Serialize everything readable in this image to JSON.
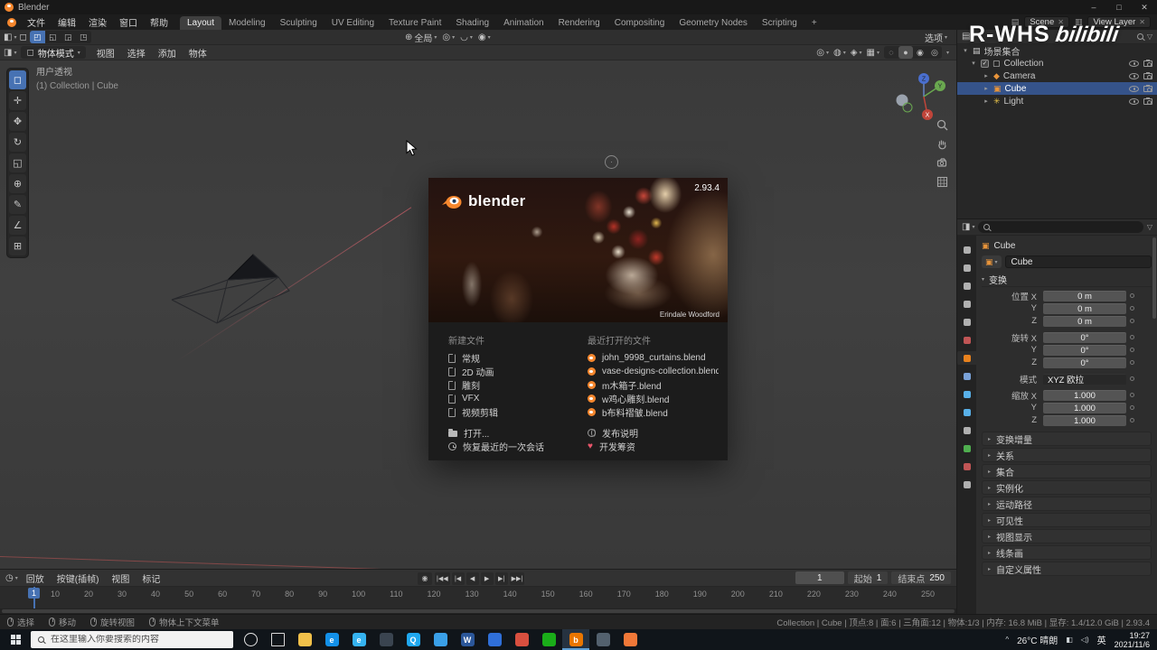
{
  "titlebar": {
    "title": "Blender",
    "min": "–",
    "max": "□",
    "close": "✕"
  },
  "watermark": {
    "part1": "R-WHS",
    "part2": "bilibili"
  },
  "menubar": {
    "menus": [
      "文件",
      "编辑",
      "渲染",
      "窗口",
      "帮助"
    ],
    "workspaces": [
      {
        "label": "Layout",
        "active": true
      },
      {
        "label": "Modeling"
      },
      {
        "label": "Sculpting"
      },
      {
        "label": "UV Editing"
      },
      {
        "label": "Texture Paint"
      },
      {
        "label": "Shading"
      },
      {
        "label": "Animation"
      },
      {
        "label": "Rendering"
      },
      {
        "label": "Compositing"
      },
      {
        "label": "Geometry Nodes"
      },
      {
        "label": "Scripting"
      },
      {
        "label": "+"
      }
    ],
    "scene_label": "Scene",
    "view_layer_label": "View Layer"
  },
  "tool_settings": {
    "orientation_glyph": "⊕",
    "orientation": "全局",
    "pivot_glyph": "◎",
    "magnet_glyph": "◡",
    "falloff_glyph": "◉",
    "options": "选项",
    "select_modes": [
      {
        "glyph": "◰",
        "active": true
      },
      {
        "glyph": "◱"
      },
      {
        "glyph": "◲"
      },
      {
        "glyph": "◳"
      }
    ]
  },
  "viewport": {
    "header": {
      "mode": "物体模式",
      "menus": [
        "视图",
        "选择",
        "添加",
        "物体"
      ]
    },
    "shading_modes": [
      {
        "glyph": "◌"
      },
      {
        "glyph": "●",
        "active": true
      },
      {
        "glyph": "◉"
      },
      {
        "glyph": "◎"
      }
    ],
    "header_icons": [
      {
        "glyph": "◎"
      },
      {
        "glyph": "◍"
      },
      {
        "glyph": "◈"
      },
      {
        "glyph": "▦"
      }
    ],
    "tools": [
      {
        "glyph": "◻",
        "name": "select-box",
        "active": true
      },
      {
        "glyph": "✛",
        "name": "cursor"
      },
      {
        "glyph": "✥",
        "name": "move"
      },
      {
        "glyph": "↻",
        "name": "rotate"
      },
      {
        "glyph": "◱",
        "name": "scale"
      },
      {
        "glyph": "⊕",
        "name": "transform"
      },
      {
        "glyph": "✎",
        "name": "annotate"
      },
      {
        "glyph": "∠",
        "name": "measure"
      },
      {
        "glyph": "⊞",
        "name": "add-cube"
      }
    ],
    "overlay": {
      "line1": "用户透视",
      "line2": "(1) Collection | Cube"
    },
    "gizmo": {
      "x": "X",
      "y": "Y",
      "z": "Z"
    }
  },
  "splash": {
    "version": "2.93.4",
    "brand": "blender",
    "credit": "Erindale Woodford",
    "new_file_title": "新建文件",
    "new_file_items": [
      "常规",
      "2D 动画",
      "雕刻",
      "VFX",
      "视频剪辑"
    ],
    "open_label": "打开...",
    "recover_label": "恢复最近的一次会话",
    "recent_title": "最近打开的文件",
    "recent_items": [
      "john_9998_curtains.blend",
      "vase-designs-collection.blend",
      "m木箱子.blend",
      "w鸡心雕刻.blend",
      "b布料褶皱.blend"
    ],
    "release_notes": "发布说明",
    "dev_fund": "开发筹资"
  },
  "outliner": {
    "root": "场景集合",
    "rows": [
      {
        "label": "Collection",
        "glyph": "▢",
        "color": "#d8d8d8",
        "lvl1": true,
        "expanded": true,
        "checkbox": true
      },
      {
        "label": "Camera",
        "glyph": "◆",
        "color": "#e8943a",
        "lvl2": true
      },
      {
        "label": "Cube",
        "glyph": "▣",
        "color": "#e8943a",
        "lvl2": true,
        "selected": true
      },
      {
        "label": "Light",
        "glyph": "✳",
        "color": "#e8c44a",
        "lvl2": true
      }
    ]
  },
  "properties": {
    "breadcrumb": "Cube",
    "name_value": "Cube",
    "transform_title": "变换",
    "tabs": [
      {
        "name": "tool",
        "color": "#b0b0b0"
      },
      {
        "name": "render",
        "color": "#b0b0b0"
      },
      {
        "name": "output",
        "color": "#b0b0b0"
      },
      {
        "name": "view-layer",
        "color": "#b0b0b0"
      },
      {
        "name": "scene",
        "color": "#b0b0b0"
      },
      {
        "name": "world",
        "color": "#c05555"
      },
      {
        "name": "object",
        "color": "#e8821e",
        "active": true
      },
      {
        "name": "modifiers",
        "color": "#7aa2d8"
      },
      {
        "name": "particles",
        "color": "#58b0e8"
      },
      {
        "name": "physics",
        "color": "#58b0e8"
      },
      {
        "name": "constraints",
        "color": "#b0b0b0"
      },
      {
        "name": "object-data",
        "color": "#4fae4f"
      },
      {
        "name": "material",
        "color": "#c05555"
      },
      {
        "name": "texture",
        "color": "#b0b0b0"
      }
    ],
    "fields": [
      {
        "label": "位置 X",
        "value": "0 m"
      },
      {
        "label": "Y",
        "value": "0 m"
      },
      {
        "label": "Z",
        "value": "0 m"
      },
      {
        "label": "旋转 X",
        "value": "0°",
        "gap_before": true
      },
      {
        "label": "Y",
        "value": "0°"
      },
      {
        "label": "Z",
        "value": "0°"
      },
      {
        "label": "模式",
        "value": "XYZ 欧拉",
        "dropdown": true,
        "gap_before": true
      },
      {
        "label": "缩放 X",
        "value": "1.000",
        "gap_before": true
      },
      {
        "label": "Y",
        "value": "1.000"
      },
      {
        "label": "Z",
        "value": "1.000"
      }
    ],
    "sections": [
      "变换增量",
      "关系",
      "集合",
      "实例化",
      "运动路径",
      "可见性",
      "视图显示",
      "线条画",
      "自定义属性"
    ]
  },
  "timeline": {
    "menus": [
      "回放",
      "按键(插帧)",
      "视图",
      "标记"
    ],
    "playback_buttons": [
      {
        "glyph": "|◀◀",
        "name": "jump-start"
      },
      {
        "glyph": "|◀",
        "name": "prev-keyframe"
      },
      {
        "glyph": "◀",
        "name": "play-reverse"
      },
      {
        "glyph": "▶",
        "name": "play"
      },
      {
        "glyph": "▶|",
        "name": "next-keyframe"
      },
      {
        "glyph": "▶▶|",
        "name": "jump-end"
      }
    ],
    "current_frame": "1",
    "frame_value": "1",
    "start_label": "起始",
    "start_value": "1",
    "end_label": "结束点",
    "end_value": "250",
    "ruler": [
      "10",
      "20",
      "30",
      "40",
      "50",
      "60",
      "70",
      "80",
      "90",
      "100",
      "110",
      "120",
      "130",
      "140",
      "150",
      "160",
      "170",
      "180",
      "190",
      "200",
      "210",
      "220",
      "230",
      "240",
      "250"
    ]
  },
  "statusbar": {
    "hints": [
      "选择",
      "移动",
      "旋转视图",
      "物体上下文菜单"
    ],
    "info": "Collection | Cube | 顶点:8 | 面:6 | 三角面:12 | 物体:1/3 | 内存: 16.8 MiB | 显存: 1.4/12.0 GiB | 2.93.4"
  },
  "taskbar": {
    "search_placeholder": "在这里输入你要搜索的内容",
    "icons": [
      {
        "name": "cortana",
        "color": "#ffffff",
        "ring": true
      },
      {
        "name": "task-view",
        "color": "#e8e8e8",
        "frame": true
      },
      {
        "name": "file-explorer",
        "color": "#f0c04a"
      },
      {
        "name": "edge-browser",
        "color": "#1390e8",
        "letter": "e"
      },
      {
        "name": "internet-explorer",
        "color": "#35b3f0",
        "letter": "e"
      },
      {
        "name": "app-dark",
        "color": "#3a4450"
      },
      {
        "name": "qq",
        "color": "#20a8f0",
        "letter": "Q"
      },
      {
        "name": "photos",
        "color": "#3aa0e8"
      },
      {
        "name": "word",
        "color": "#2b579a",
        "letter": "W"
      },
      {
        "name": "app-blue",
        "color": "#2f6fd8"
      },
      {
        "name": "browser",
        "color": "#d84f3f"
      },
      {
        "name": "wechat",
        "color": "#1aad19"
      },
      {
        "name": "blender",
        "color": "#ea7600",
        "letter": "b",
        "active": true
      },
      {
        "name": "app-gray",
        "color": "#53616e"
      },
      {
        "name": "app-orange",
        "color": "#f07838"
      }
    ],
    "tray": {
      "expand": "^",
      "weather": "26°C 晴朗",
      "lang": "英",
      "time": "19:27",
      "date": "2021/11/6"
    }
  }
}
